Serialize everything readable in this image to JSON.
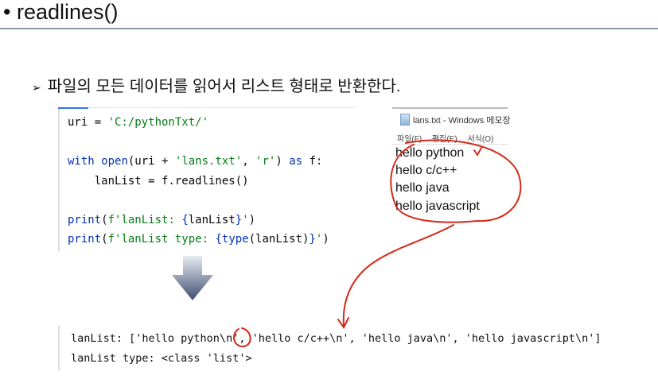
{
  "slide": {
    "title": "• readlines()",
    "bullet": "파일의 모든 데이터를 읽어서 리스트 형태로 반환한다."
  },
  "code": {
    "lines": [
      [
        {
          "t": "uri = ",
          "c": ""
        },
        {
          "t": "'C:/pythonTxt/'",
          "c": "st"
        }
      ],
      [
        {
          "t": "with ",
          "c": "kw"
        },
        {
          "t": "open",
          "c": "kw"
        },
        {
          "t": "(uri + ",
          "c": ""
        },
        {
          "t": "'lans.txt'",
          "c": "st"
        },
        {
          "t": ", ",
          "c": ""
        },
        {
          "t": "'r'",
          "c": "st"
        },
        {
          "t": ") ",
          "c": ""
        },
        {
          "t": "as",
          "c": "kw"
        },
        {
          "t": " f:",
          "c": ""
        }
      ],
      [
        {
          "t": "    lanList = f.readlines()",
          "c": ""
        }
      ],
      [
        {
          "t": "print",
          "c": "kw"
        },
        {
          "t": "(",
          "c": ""
        },
        {
          "t": "f'lanList: ",
          "c": "st"
        },
        {
          "t": "{",
          "c": "kw"
        },
        {
          "t": "lanList",
          "c": ""
        },
        {
          "t": "}",
          "c": "kw"
        },
        {
          "t": "'",
          "c": "st"
        },
        {
          "t": ")",
          "c": ""
        }
      ],
      [
        {
          "t": "print",
          "c": "kw"
        },
        {
          "t": "(",
          "c": ""
        },
        {
          "t": "f'lanList type: ",
          "c": "st"
        },
        {
          "t": "{",
          "c": "kw"
        },
        {
          "t": "type",
          "c": "kw"
        },
        {
          "t": "(lanList)",
          "c": ""
        },
        {
          "t": "}",
          "c": "kw"
        },
        {
          "t": "'",
          "c": "st"
        },
        {
          "t": ")",
          "c": ""
        }
      ]
    ]
  },
  "notepad": {
    "title": "lans.txt - Windows 메모장",
    "menu": [
      "파일(F)",
      "편집(E)",
      "서식(O)"
    ],
    "lines": [
      "hello python",
      "hello c/c++",
      "hello java",
      "hello javascript"
    ]
  },
  "output": {
    "lines": [
      "lanList: ['hello python\\n', 'hello c/c++\\n', 'hello java\\n', 'hello javascript\\n']",
      "lanList type: <class 'list'>"
    ]
  },
  "colors": {
    "annotation": "#d42a1a",
    "keyword": "#0033b3",
    "string": "#067d17"
  }
}
